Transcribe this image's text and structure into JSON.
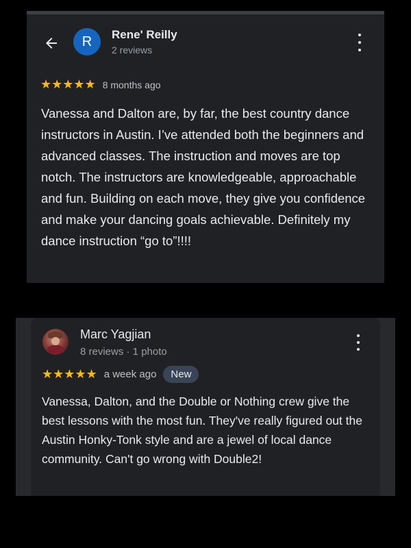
{
  "review_1": {
    "reviewer_name": "Rene' Reilly",
    "reviewer_meta": "2 reviews",
    "avatar_initial": "R",
    "stars": "★★★★★",
    "rating": 5,
    "time": "8 months ago",
    "text": "Vanessa and Dalton are, by far, the best country dance instructors in Austin. I’ve attended both the beginners and advanced classes. The instruction and moves are top notch. The instructors are knowledgeable, approachable and fun. Building on each move, they give you confidence and make your dancing goals achievable. Definitely my dance instruction “go to”!!!!",
    "back_icon": "arrow-back-icon",
    "menu_icon": "more-vert-icon"
  },
  "review_2": {
    "reviewer_name": "Marc Yagjian",
    "reviewer_meta": "8 reviews · 1 photo",
    "stars": "★★★★★",
    "rating": 5,
    "time": "a week ago",
    "badge": "New",
    "text": "Vanessa, Dalton, and the Double or Nothing crew give the best lessons with the most fun. They've really figured out the Austin Honky-Tonk style and are a jewel of local dance community. Can't go wrong with Double2!",
    "menu_icon": "more-vert-icon"
  },
  "colors": {
    "background": "#000000",
    "card": "#202124",
    "star": "#fbbc04",
    "avatar_blue": "#1565c0",
    "badge_bg": "#394457"
  }
}
